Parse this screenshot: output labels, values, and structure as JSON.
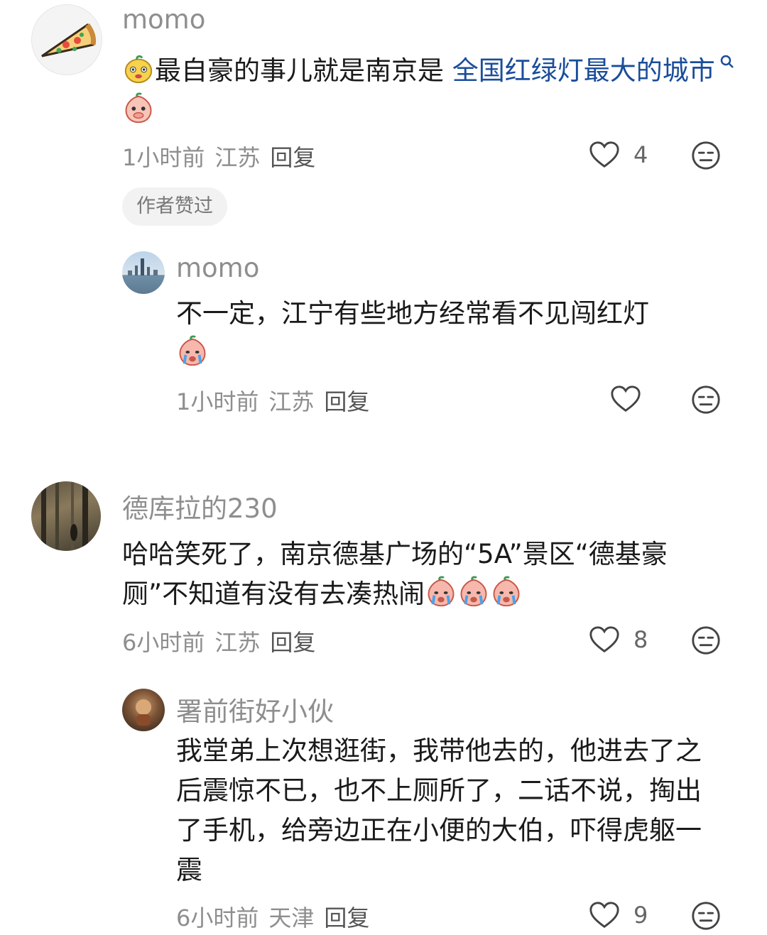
{
  "comments": [
    {
      "user": "momo",
      "text_before": "最自豪的事儿就是南京是 ",
      "link": "全国红绿灯最大的城市",
      "time": "1小时前",
      "location": "江苏",
      "reply": "回复",
      "likes": "4",
      "badge": "作者赞过",
      "replies": [
        {
          "user": "momo",
          "text": "不一定，江宁有些地方经常看不见闯红灯",
          "time": "1小时前",
          "location": "江苏",
          "reply": "回复",
          "likes": ""
        }
      ]
    },
    {
      "user": "德库拉的230",
      "text": "哈哈笑死了，南京德基广场的“5A”景区“德基豪厕”不知道有没有去凑热闹",
      "time": "6小时前",
      "location": "江苏",
      "reply": "回复",
      "likes": "8",
      "replies": [
        {
          "user": "署前街好小伙",
          "text": "我堂弟上次想逛街，我带他去的，他进去了之后震惊不已，也不上厕所了，二话不说，掏出了手机，给旁边正在小便的大伯，吓得虎躯一震",
          "time": "6小时前",
          "location": "天津",
          "reply": "回复",
          "likes": "9"
        }
      ]
    }
  ],
  "icons": {
    "like": "heart-outline-icon",
    "dislike": "neutral-face-icon",
    "search": "search-icon"
  }
}
